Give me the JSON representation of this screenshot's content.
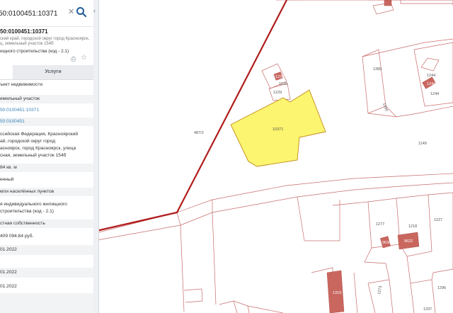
{
  "search": {
    "value": "50:0100451:10371",
    "clear_icon": "close-icon",
    "search_icon": "search-icon"
  },
  "card": {
    "number": "50:0100451:10371",
    "address_line1": "ский край, городской округ город Красноярск,",
    "address_line2": "ц, земельный участок 154б",
    "use": "ищного строительства (код - 2.1)"
  },
  "tabs": {
    "services": "Услуги"
  },
  "rows": [
    "ъект недвижимости",
    "емельный участок",
    "50:0100451:10371",
    "50:0100451",
    "ссийская Федерация, Красноярский",
    "ай, городской округ город",
    "асноярск, город Красноярск, улица",
    "сная, земельный участок 154б",
    "84 кв. м",
    "енный",
    "мли населённых пунктов",
    "я индивидуального жилищного",
    "строительства (код - 2.1)",
    "стная собственность",
    "409 094,64 руб.",
    "01.2022",
    "01.2022",
    "01.2022"
  ],
  "map_labels": {
    "selected": "10371",
    "p4872": "487/2",
    "p1149": "1149",
    "p1229a": "1229",
    "p1229b": "1229",
    "p1229c": "1229",
    "p1389": "1389",
    "p1244a": "1244",
    "p1244b": "1244",
    "p1390": "1390",
    "p1277": "1277",
    "p1218": "1218",
    "p1227": "1227",
    "p9622": "9622",
    "p9630": "9630",
    "p1319": "1319",
    "p1296": "1296",
    "p1273": "1273",
    "p1337": "1337"
  },
  "colors": {
    "selected_fill": "#fbf56f",
    "boundary": "#b01c1c",
    "parcel_line": "#c96b6b",
    "building": "#c9675f",
    "link": "#3a83b8"
  }
}
